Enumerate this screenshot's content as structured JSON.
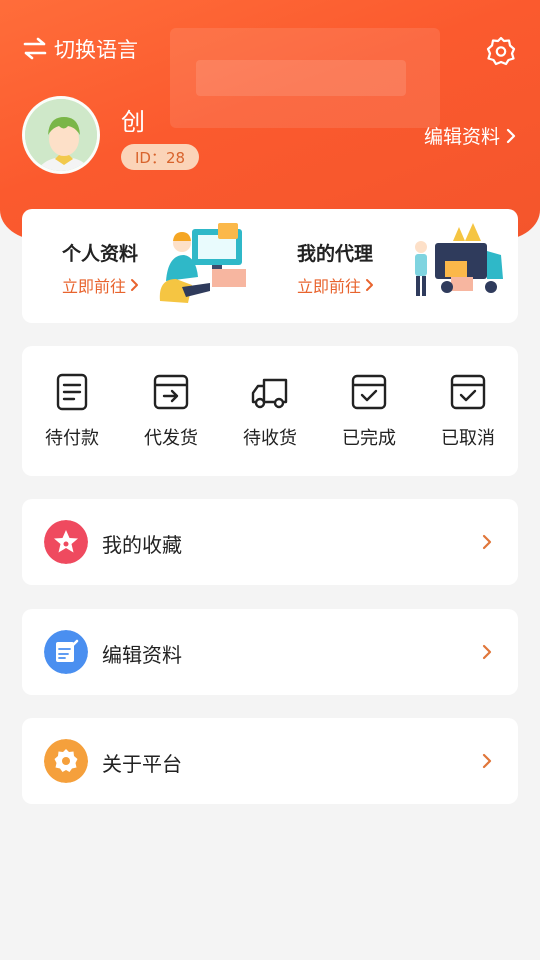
{
  "header": {
    "language_label": "切换语言",
    "username": "创",
    "id_label": "ID：28",
    "edit_profile": "编辑资料"
  },
  "promo": [
    {
      "title": "个人资料",
      "link": "立即前往"
    },
    {
      "title": "我的代理",
      "link": "立即前往"
    }
  ],
  "orders": [
    {
      "label": "待付款",
      "icon": "document-icon"
    },
    {
      "label": "代发货",
      "icon": "box-arrow-icon"
    },
    {
      "label": "待收货",
      "icon": "truck-icon"
    },
    {
      "label": "已完成",
      "icon": "box-check-icon"
    },
    {
      "label": "已取消",
      "icon": "box-check-icon"
    }
  ],
  "menu": [
    {
      "label": "我的收藏",
      "icon": "star-icon",
      "color": "#ef4a5f"
    },
    {
      "label": "编辑资料",
      "icon": "edit-icon",
      "color": "#4a8ff0"
    },
    {
      "label": "关于平台",
      "icon": "gear-icon",
      "color": "#f5a03c"
    }
  ],
  "colors": {
    "accent": "#fb5a2e",
    "link": "#e8642e"
  }
}
